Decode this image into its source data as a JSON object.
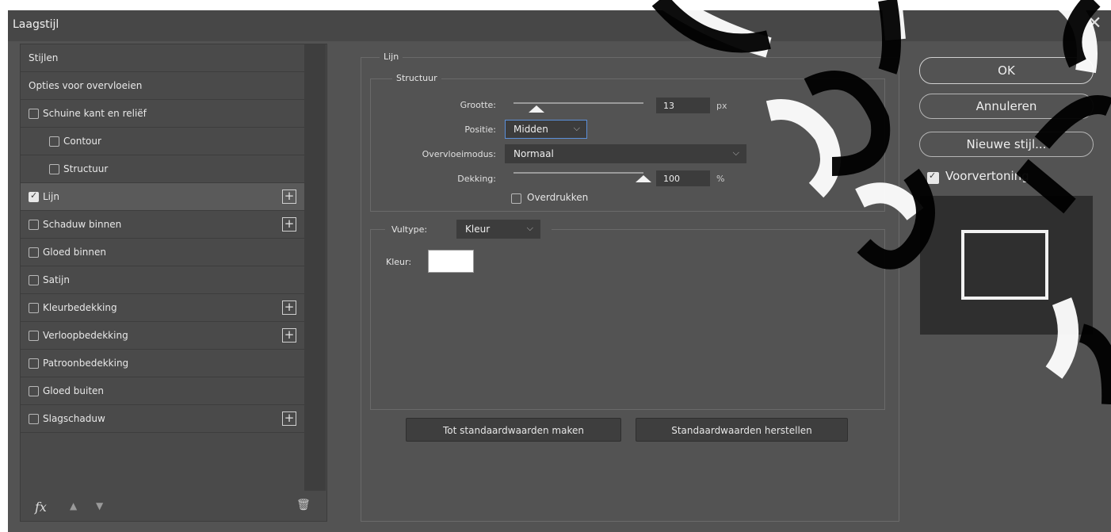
{
  "window": {
    "title": "Laagstijl",
    "close_glyph": "✕"
  },
  "left_list": {
    "items": [
      {
        "label": "Stijlen",
        "checkbox": false,
        "checked": false,
        "indent": false,
        "plus": false,
        "active": false
      },
      {
        "label": "Opties voor overvloeien",
        "checkbox": false,
        "checked": false,
        "indent": false,
        "plus": false,
        "active": false
      },
      {
        "label": "Schuine kant en reliëf",
        "checkbox": true,
        "checked": false,
        "indent": false,
        "plus": false,
        "active": false
      },
      {
        "label": "Contour",
        "checkbox": true,
        "checked": false,
        "indent": true,
        "plus": false,
        "active": false
      },
      {
        "label": "Structuur",
        "checkbox": true,
        "checked": false,
        "indent": true,
        "plus": false,
        "active": false
      },
      {
        "label": "Lijn",
        "checkbox": true,
        "checked": true,
        "indent": false,
        "plus": true,
        "active": true
      },
      {
        "label": "Schaduw binnen",
        "checkbox": true,
        "checked": false,
        "indent": false,
        "plus": true,
        "active": false
      },
      {
        "label": "Gloed binnen",
        "checkbox": true,
        "checked": false,
        "indent": false,
        "plus": false,
        "active": false
      },
      {
        "label": "Satijn",
        "checkbox": true,
        "checked": false,
        "indent": false,
        "plus": false,
        "active": false
      },
      {
        "label": "Kleurbedekking",
        "checkbox": true,
        "checked": false,
        "indent": false,
        "plus": true,
        "active": false
      },
      {
        "label": "Verloopbedekking",
        "checkbox": true,
        "checked": false,
        "indent": false,
        "plus": true,
        "active": false
      },
      {
        "label": "Patroonbedekking",
        "checkbox": true,
        "checked": false,
        "indent": false,
        "plus": false,
        "active": false
      },
      {
        "label": "Gloed buiten",
        "checkbox": true,
        "checked": false,
        "indent": false,
        "plus": false,
        "active": false
      },
      {
        "label": "Slagschaduw",
        "checkbox": true,
        "checked": false,
        "indent": false,
        "plus": true,
        "active": false
      }
    ],
    "plus_glyph": "+",
    "footer": {
      "fx": "fx",
      "up_glyph": "▲",
      "down_glyph": "▼",
      "trash_glyph": "🗑"
    }
  },
  "stroke": {
    "group_label": "Lijn",
    "structure_label": "Structuur",
    "size_label": "Grootte:",
    "size_value": "13",
    "size_unit": "px",
    "size_fraction": 0.07,
    "position_label": "Positie:",
    "position_value": "Midden",
    "blend_label": "Overvloeimodus:",
    "blend_value": "Normaal",
    "opacity_label": "Dekking:",
    "opacity_value": "100",
    "opacity_unit": "%",
    "opacity_fraction": 1.0,
    "overprint_label": "Overdrukken",
    "fill_type_label": "Vultype:",
    "fill_type_value": "Kleur",
    "color_label": "Kleur:",
    "color_value": "#ffffff",
    "chevron_glyph": "⌵"
  },
  "buttons": {
    "make_default": "Tot standaardwaarden maken",
    "reset_default": "Standaardwaarden herstellen",
    "ok": "OK",
    "cancel": "Annuleren",
    "new_style": "Nieuwe stijl...",
    "preview_label": "Voorvertoning",
    "preview_checked": true
  },
  "colors": {
    "dialog_bg": "#535353",
    "titlebar_bg": "#474747",
    "field_bg": "#3c3c3c",
    "focus_border": "#5b8fd9",
    "preview_bg": "#2f2f2f"
  }
}
